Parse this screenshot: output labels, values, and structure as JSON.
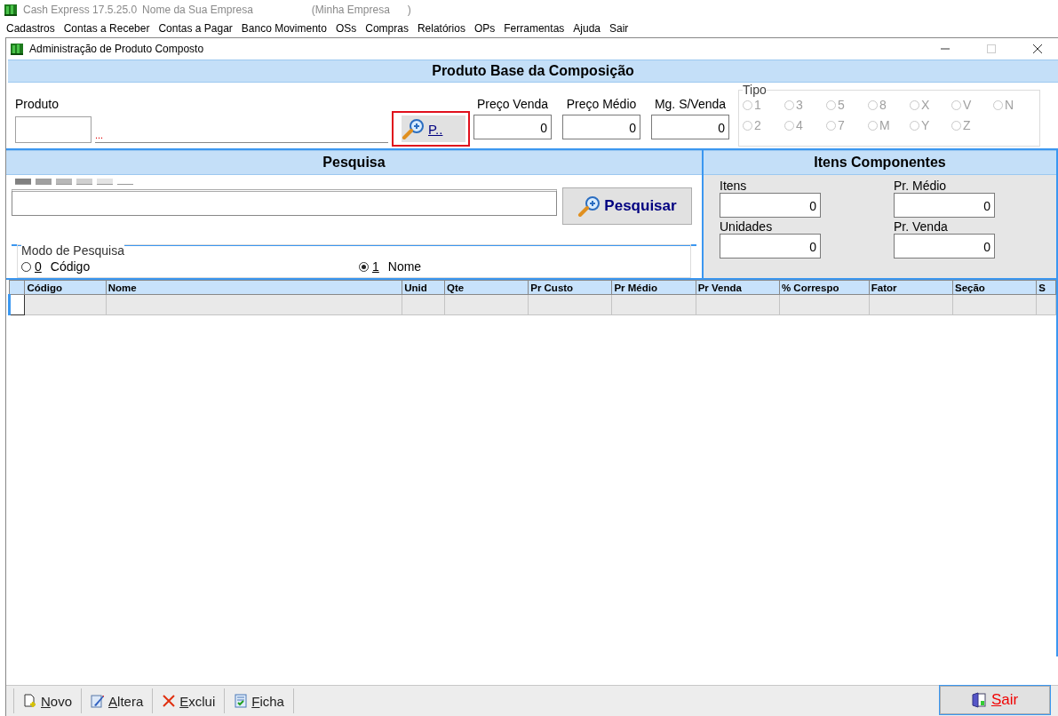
{
  "app": {
    "title": "Cash Express 17.5.25.0",
    "company": "Nome da Sua Empresa",
    "company_alias": "(Minha Empresa      )"
  },
  "menu": [
    "Cadastros",
    "Contas a Receber",
    "Contas a Pagar",
    "Banco Movimento",
    "OSs",
    "Compras",
    "Relatórios",
    "OPs",
    "Ferramentas",
    "Ajuda",
    "Sair"
  ],
  "window": {
    "title": "Administração de Produto Composto"
  },
  "base": {
    "header": "Produto Base da Composição",
    "produto_label": "Produto",
    "description": "...",
    "search_button": {
      "label": "P..",
      "focused": true
    },
    "prices": [
      {
        "label": "Preço Venda",
        "value": "0"
      },
      {
        "label": "Preço Médio",
        "value": "0"
      },
      {
        "label": "Mg. S/Venda",
        "value": "0"
      }
    ],
    "tipo": {
      "label": "Tipo",
      "options": [
        {
          "label": "1",
          "selected": false,
          "disabled": true
        },
        {
          "label": "3",
          "selected": false,
          "disabled": true
        },
        {
          "label": "5",
          "selected": false,
          "disabled": true
        },
        {
          "label": "8",
          "selected": false,
          "disabled": true
        },
        {
          "label": "X",
          "selected": false,
          "disabled": true
        },
        {
          "label": "V",
          "selected": false,
          "disabled": true
        },
        {
          "label": "N",
          "selected": false,
          "disabled": true
        },
        {
          "label": "2",
          "selected": false,
          "disabled": true
        },
        {
          "label": "4",
          "selected": false,
          "disabled": true
        },
        {
          "label": "7",
          "selected": false,
          "disabled": true
        },
        {
          "label": "M",
          "selected": false,
          "disabled": true
        },
        {
          "label": "Y",
          "selected": false,
          "disabled": true
        },
        {
          "label": "Z",
          "selected": false,
          "disabled": true
        }
      ]
    }
  },
  "pesquisa": {
    "header": "Pesquisa",
    "button": "Pesquisar",
    "mode": {
      "label": "Modo de Pesquisa",
      "options": [
        {
          "key": "0",
          "label": "Código",
          "selected": false
        },
        {
          "key": "1",
          "label": "Nome",
          "selected": true
        }
      ]
    }
  },
  "itens": {
    "header": "Itens Componentes",
    "fields": [
      {
        "label": "Itens",
        "value": "0"
      },
      {
        "label": "Pr. Médio",
        "value": "0"
      },
      {
        "label": "Unidades",
        "value": "0"
      },
      {
        "label": "Pr. Venda",
        "value": "0"
      }
    ]
  },
  "table": {
    "columns": [
      "Código",
      "Nome",
      "Unid",
      "Qte",
      "Pr Custo",
      "Pr Médio",
      "Pr Venda",
      "% Correspo",
      "Fator",
      "Seção",
      "S"
    ]
  },
  "toolbar": [
    {
      "label": "Novo",
      "kind": "new"
    },
    {
      "label": "Altera",
      "kind": "edit"
    },
    {
      "label": "Exclui",
      "kind": "delete"
    },
    {
      "label": "Ficha",
      "kind": "sheet"
    }
  ],
  "exit_button": "Sair"
}
